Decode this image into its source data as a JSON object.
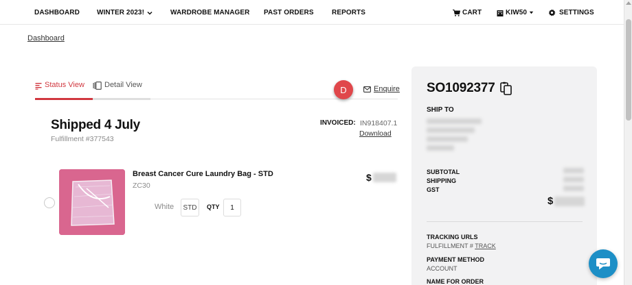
{
  "nav": {
    "dashboard": "DASHBOARD",
    "winter": "WINTER 2023!",
    "wardrobe": "WARDROBE MANAGER",
    "past_orders": "PAST ORDERS",
    "reports": "REPORTS",
    "cart": "CART",
    "account": "KIW50",
    "settings": "SETTINGS"
  },
  "breadcrumb": "Dashboard",
  "tabs": {
    "status": "Status View",
    "detail": "Detail View",
    "active": "status"
  },
  "badge": "D",
  "enquire": "Enquire",
  "shipment": {
    "title": "Shipped 4 July",
    "fulfillment": "Fulfillment #377543",
    "invoiced_label": "INVOICED:",
    "invoiced_value": "IN918407.1",
    "download": "Download"
  },
  "product": {
    "name": "Breast Cancer Cure Laundry Bag - STD",
    "code": "ZC30",
    "price_symbol": "$",
    "color": "White",
    "size": "STD",
    "qty_label": "QTY",
    "qty": "1"
  },
  "summary": {
    "order_number": "SO1092377",
    "ship_to": "SHIP TO",
    "subtotal": "SUBTOTAL",
    "shipping": "SHIPPING",
    "gst": "GST",
    "total_symbol": "$",
    "tracking_label": "TRACKING URLS",
    "tracking_prefix": "FULFILLMENT #",
    "tracking_link": "TRACK",
    "payment_label": "PAYMENT METHOD",
    "payment_value": "ACCOUNT",
    "name_label": "NAME FOR ORDER"
  },
  "colors": {
    "accent_red": "#d1373f",
    "badge_red": "#e0474b",
    "chat_blue": "#1d8fc6",
    "panel_bg": "#f2f2f3"
  },
  "icons": {
    "cart": "cart-icon",
    "account": "building-icon",
    "settings": "gear-icon",
    "enquire": "envelope-icon",
    "copy": "copy-icon",
    "chat": "chat-icon"
  }
}
